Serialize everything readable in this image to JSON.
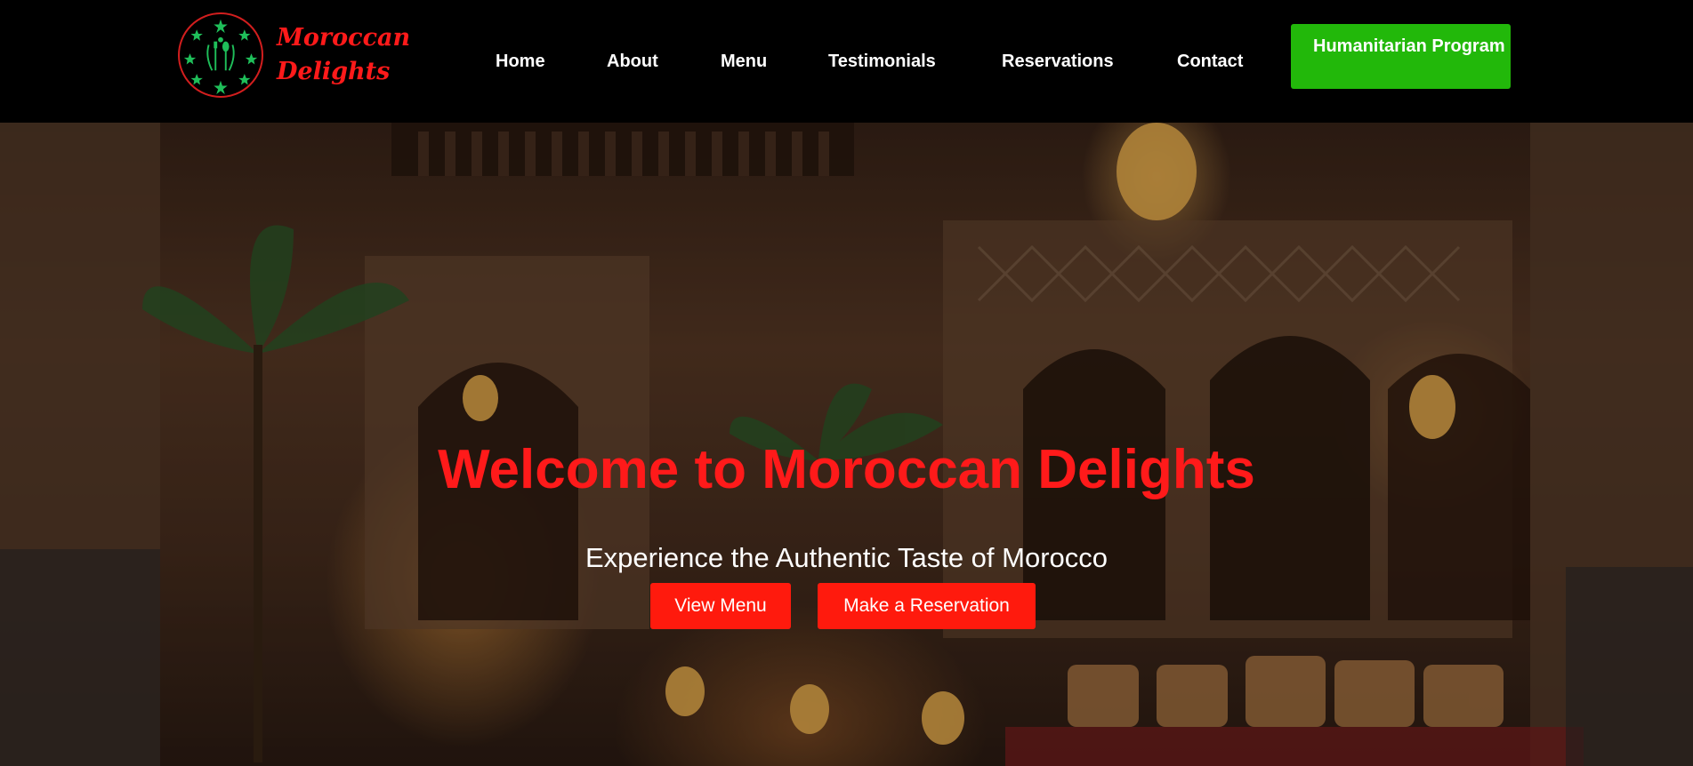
{
  "brand": {
    "name_line1": "Moroccan",
    "name_line2": "Delights"
  },
  "nav": {
    "items": [
      "Home",
      "About",
      "Menu",
      "Testimonials",
      "Reservations",
      "Contact"
    ],
    "cta": "Humanitarian Program"
  },
  "hero": {
    "title": "Welcome to Moroccan Delights",
    "subtitle": "Experience the Authentic Taste of Morocco",
    "view_menu": "View Menu",
    "make_reservation": "Make a Reservation"
  },
  "colors": {
    "header_bg": "#000000",
    "brand_red": "#ff1a1a",
    "cta_green": "#22b80a",
    "button_red": "#ff1a0d",
    "logo_green": "#1fbf5a"
  }
}
